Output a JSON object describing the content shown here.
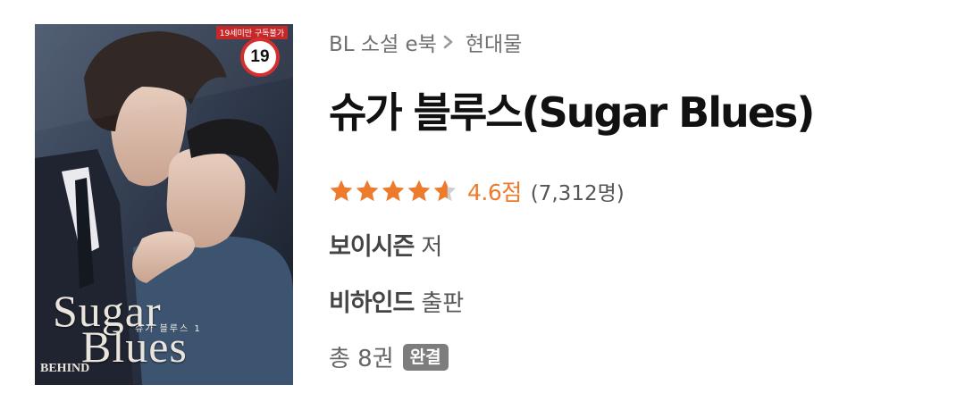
{
  "breadcrumb": {
    "category": "BL 소설 e북",
    "subcategory": "현대물"
  },
  "book": {
    "title": "슈가 블루스(Sugar Blues)",
    "rating": {
      "stars_value": 4.6,
      "stars_max": 5,
      "score_text": "4.6점",
      "count_text": "(7,312명)",
      "star_color": "#ee7a2c",
      "star_empty_color": "#cfcfcf"
    },
    "author": {
      "name": "보이시즌",
      "suffix": "저"
    },
    "publisher": {
      "name": "비하인드",
      "suffix": "출판"
    },
    "volumes": {
      "text": "총 8권",
      "status_badge": "완결"
    }
  },
  "cover": {
    "age_banner": "19세미만 구독불가",
    "age_rating": "19",
    "title_line_1": "Sugar",
    "title_line_2": "Blues",
    "subtitle": "슈가 블루스 1",
    "publisher_logo": "BEHIND"
  },
  "icons": {
    "breadcrumb_separator": "chevron-right-icon",
    "rating_star": "star-icon"
  }
}
